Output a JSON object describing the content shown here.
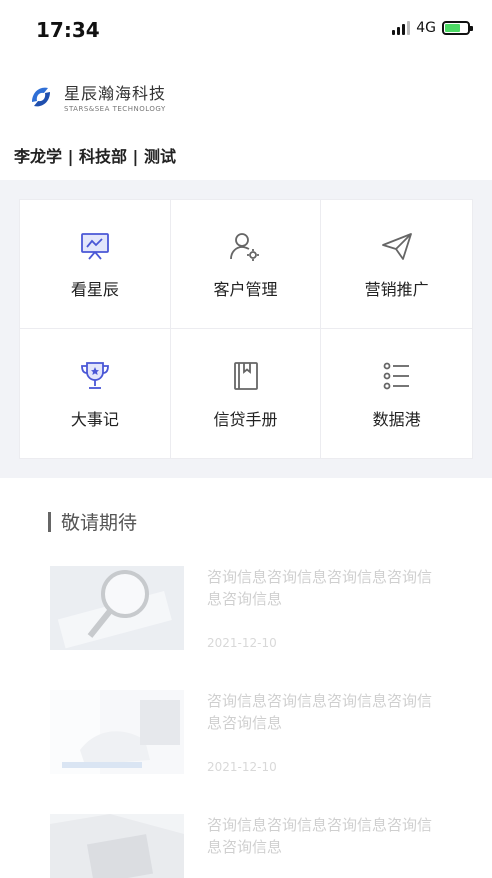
{
  "status_bar": {
    "time": "17:34",
    "network": "4G",
    "battery_level": 0.7
  },
  "brand": {
    "name_cn": "星辰瀚海科技",
    "name_en": "STARS&SEA TECHNOLOGY"
  },
  "user_line": "李龙学 | 科技部 | 测试",
  "menu": [
    {
      "label": "看星辰",
      "icon": "presentation-board-icon"
    },
    {
      "label": "客户管理",
      "icon": "user-settings-icon"
    },
    {
      "label": "营销推广",
      "icon": "paper-plane-icon"
    },
    {
      "label": "大事记",
      "icon": "trophy-icon"
    },
    {
      "label": "信贷手册",
      "icon": "book-icon"
    },
    {
      "label": "数据港",
      "icon": "list-icon"
    }
  ],
  "section": {
    "title": "敬请期待"
  },
  "news": [
    {
      "title": "咨询信息咨询信息咨询信息咨询信息咨询信息",
      "date": "2021-12-10"
    },
    {
      "title": "咨询信息咨询信息咨询信息咨询信息咨询信息",
      "date": "2021-12-10"
    },
    {
      "title": "咨询信息咨询信息咨询信息咨询信息咨询信息",
      "date": ""
    }
  ],
  "colors": {
    "accent": "#4a57d6",
    "icon_grey": "#666666",
    "band": "#f2f3f7"
  }
}
